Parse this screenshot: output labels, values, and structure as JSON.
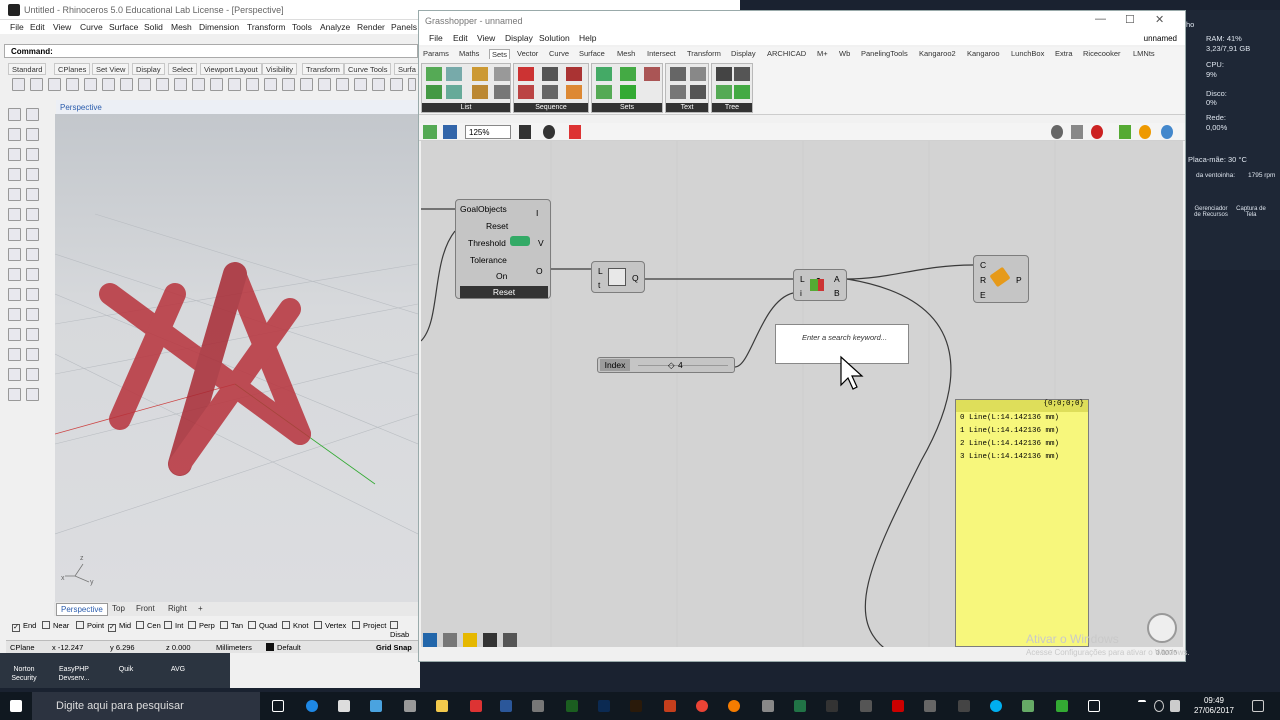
{
  "rhino": {
    "title": "Untitled - Rhinoceros 5.0 Educational Lab License - [Perspective]",
    "menu": [
      "File",
      "Edit",
      "View",
      "Curve",
      "Surface",
      "Solid",
      "Mesh",
      "Dimension",
      "Transform",
      "Tools",
      "Analyze",
      "Render",
      "Panels"
    ],
    "command_label": "Command:",
    "toolbar_tabs": [
      "Standard",
      "CPlanes",
      "Set View",
      "Display",
      "Select",
      "Viewport Layout",
      "Visibility",
      "Transform",
      "Curve Tools",
      "Surfa"
    ],
    "viewport_label": "Perspective",
    "viewport_tabs": [
      "Perspective",
      "Top",
      "Front",
      "Right"
    ],
    "osnaps": [
      {
        "label": "End",
        "on": true
      },
      {
        "label": "Near",
        "on": false
      },
      {
        "label": "Point",
        "on": false
      },
      {
        "label": "Mid",
        "on": true
      },
      {
        "label": "Cen",
        "on": false
      },
      {
        "label": "Int",
        "on": false
      },
      {
        "label": "Perp",
        "on": false
      },
      {
        "label": "Tan",
        "on": false
      },
      {
        "label": "Quad",
        "on": false
      },
      {
        "label": "Knot",
        "on": false
      },
      {
        "label": "Vertex",
        "on": false
      },
      {
        "label": "Project",
        "on": false
      },
      {
        "label": "Disab",
        "on": false
      }
    ],
    "status": {
      "cplane": "CPlane",
      "x": "x -12.247",
      "y": "y 6.296",
      "z": "z 0.000",
      "units": "Millimeters",
      "layer": "Default",
      "snap": "Grid Snap"
    },
    "axis_x": "x",
    "axis_y": "y",
    "axis_z": "z"
  },
  "desktop_icons": [
    "Norton Security",
    "EasyPHP Devserv...",
    "Quik",
    "AVG"
  ],
  "gh": {
    "title": "Grasshopper - unnamed",
    "doc_name": "unnamed",
    "menu": [
      "File",
      "Edit",
      "View",
      "Display",
      "Solution",
      "Help"
    ],
    "tabs": [
      "Params",
      "Maths",
      "Sets",
      "Vector",
      "Curve",
      "Surface",
      "Mesh",
      "Intersect",
      "Transform",
      "Display",
      "ARCHICAD",
      "M+",
      "Wb",
      "PanelingTools",
      "Kangaroo2",
      "Kangaroo",
      "LunchBox",
      "Extra",
      "Ricecooker",
      "LMNts"
    ],
    "active_tab": "Sets",
    "groups": [
      "List",
      "Sequence",
      "Sets",
      "Text",
      "Tree"
    ],
    "zoom": "125%",
    "solver": {
      "inputs": [
        "GoalObjects",
        "Reset",
        "Threshold",
        "Tolerance",
        "On"
      ],
      "outputs": [
        "I",
        "V",
        "O"
      ],
      "button": "Reset"
    },
    "explode": {
      "inputs": [
        "L",
        "t"
      ],
      "output": "Q"
    },
    "dispatch": {
      "inputs": [
        "L",
        "i"
      ],
      "outputs": [
        "A",
        "B"
      ],
      "icon_num": "2"
    },
    "curve": {
      "inputs": [
        "C",
        "R",
        "E"
      ],
      "output": "P"
    },
    "search_placeholder": "Enter a search keyword...",
    "slider": {
      "label": "Index",
      "value": "4"
    },
    "panel": {
      "header": "{0;0;0;0}",
      "rows": [
        "0 Line(L:14.142136 mm)",
        "1 Line(L:14.142136 mm)",
        "2 Line(L:14.142136 mm)",
        "3 Line(L:14.142136 mm)"
      ]
    },
    "status": "0.0076"
  },
  "perf": {
    "ram_label": "RAM: 41%",
    "ram": "3,23/7,91 GB",
    "cpu_label": "CPU:",
    "cpu": "9%",
    "disk_label": "Disco:",
    "disk": "0%",
    "net_label": "Rede:",
    "net": "0,00%",
    "mb": "Placa-mãe: 30 °C",
    "fan_label": "da ventoinha:",
    "fan": "1795 rpm",
    "res": "Gerenciador de Recursos",
    "cap": "Captura de Tela",
    "ho": "ho"
  },
  "watermark": {
    "title": "Ativar o Windows",
    "sub": "Acesse Configurações para ativar o Windows."
  },
  "taskbar": {
    "search": "Digite aqui para pesquisar",
    "time": "09:49",
    "date": "27/06/2017"
  },
  "colors": {
    "accent": "#2a5cad",
    "panel": "#f7f77c",
    "object": "#b8333c"
  }
}
